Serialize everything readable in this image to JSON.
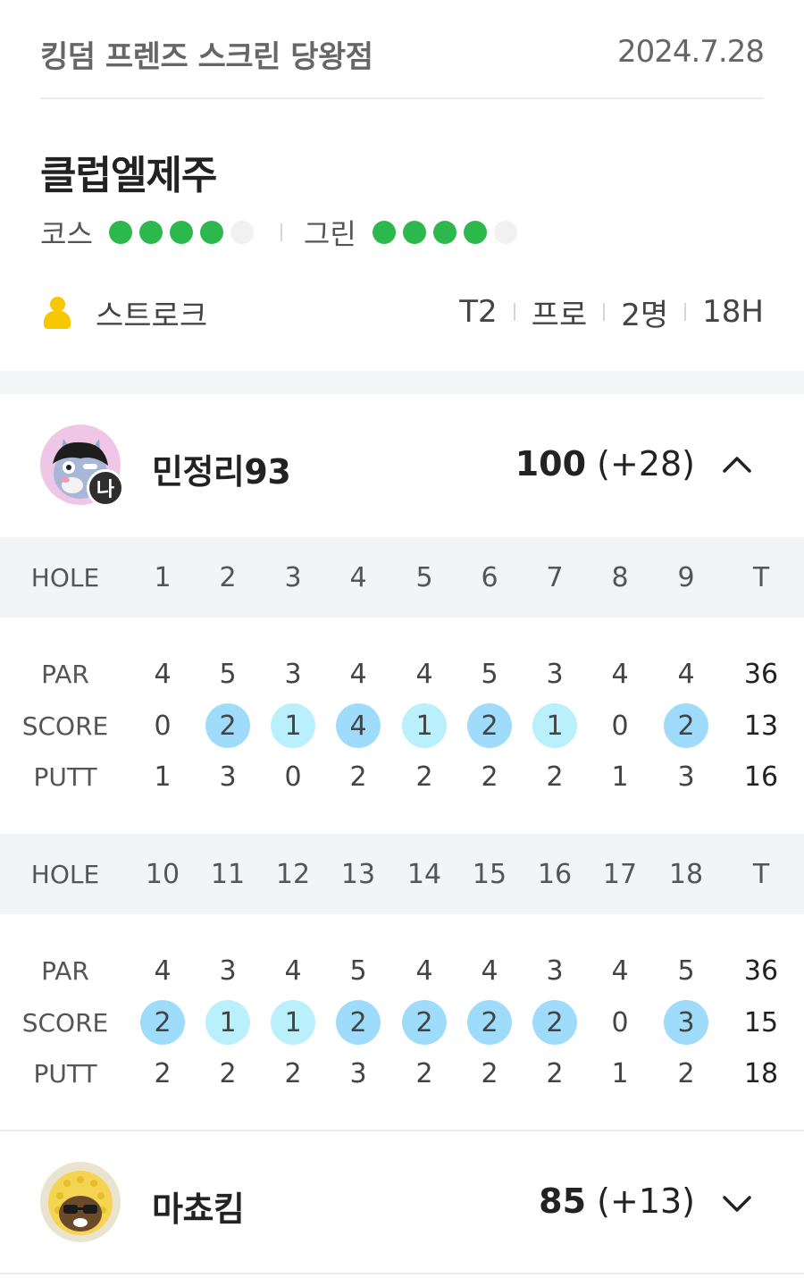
{
  "header": {
    "venue": "킹덤 프렌즈 스크린 당왕점",
    "date": "2024.7.28"
  },
  "course": {
    "name": "클럽엘제주",
    "course_label": "코스",
    "course_rating": 4,
    "green_label": "그린",
    "green_rating": 4,
    "rating_max": 5
  },
  "game": {
    "mode": "스트로크",
    "tee": "T2",
    "level": "프로",
    "players": "2명",
    "holes": "18H"
  },
  "row_labels": {
    "hole": "HOLE",
    "par": "PAR",
    "score": "SCORE",
    "putt": "PUTT",
    "total": "T"
  },
  "players": [
    {
      "name": "민정리93",
      "me_badge": "나",
      "total": "100",
      "to_par": "(+28)",
      "expanded": true,
      "front": {
        "holes": [
          "1",
          "2",
          "3",
          "4",
          "5",
          "6",
          "7",
          "8",
          "9"
        ],
        "par": [
          "4",
          "5",
          "3",
          "4",
          "4",
          "5",
          "3",
          "4",
          "4"
        ],
        "par_total": "36",
        "score": [
          "0",
          "2",
          "1",
          "4",
          "1",
          "2",
          "1",
          "0",
          "2"
        ],
        "score_total": "13",
        "putt": [
          "1",
          "3",
          "0",
          "2",
          "2",
          "2",
          "2",
          "1",
          "3"
        ],
        "putt_total": "16"
      },
      "back": {
        "holes": [
          "10",
          "11",
          "12",
          "13",
          "14",
          "15",
          "16",
          "17",
          "18"
        ],
        "par": [
          "4",
          "3",
          "4",
          "5",
          "4",
          "4",
          "3",
          "4",
          "5"
        ],
        "par_total": "36",
        "score": [
          "2",
          "1",
          "1",
          "2",
          "2",
          "2",
          "2",
          "0",
          "3"
        ],
        "score_total": "15",
        "putt": [
          "2",
          "2",
          "2",
          "3",
          "2",
          "2",
          "2",
          "1",
          "2"
        ],
        "putt_total": "18"
      }
    },
    {
      "name": "마쵸킴",
      "total": "85",
      "to_par": "(+13)",
      "expanded": false
    }
  ],
  "colors": {
    "green_dot": "#2db84d",
    "score_light": "#b9f0fb",
    "score_mid": "#9fdcfb",
    "person_icon": "#f7c800"
  }
}
